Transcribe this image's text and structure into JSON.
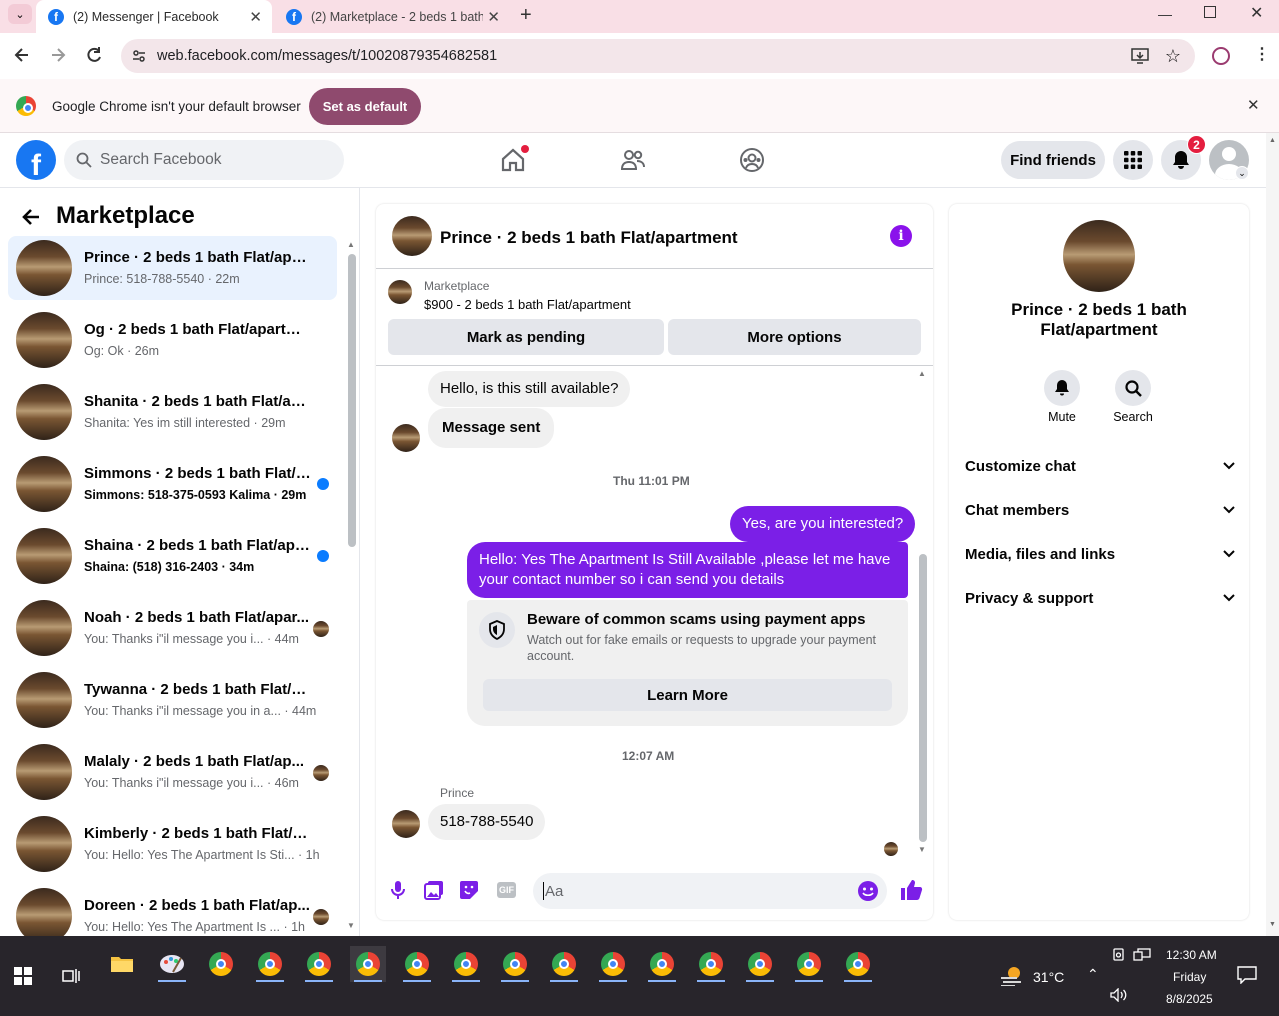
{
  "browser": {
    "tabs": [
      {
        "title": "(2) Messenger | Facebook"
      },
      {
        "title": "(2) Marketplace - 2 beds 1 bath"
      }
    ],
    "url": "web.facebook.com/messages/t/10020879354682581",
    "infobar_text": "Google Chrome isn't your default browser",
    "set_default_label": "Set as default"
  },
  "fb_header": {
    "search_placeholder": "Search Facebook",
    "find_friends_label": "Find friends",
    "notification_count": "2"
  },
  "sidebar": {
    "heading": "Marketplace",
    "conversations": [
      {
        "title": "Prince · 2 beds 1 bath Flat/apart...",
        "preview": "Prince: 518-788-5540",
        "time": "22m",
        "unread": false,
        "indicator": "none",
        "selected": true
      },
      {
        "title": "Og · 2 beds 1 bath Flat/apartment",
        "preview": "Og: Ok",
        "time": "26m",
        "unread": false,
        "indicator": "none",
        "selected": false
      },
      {
        "title": "Shanita · 2 beds 1 bath Flat/apar...",
        "preview": "Shanita: Yes im still interested",
        "time": "29m",
        "unread": false,
        "indicator": "none",
        "selected": false
      },
      {
        "title": "Simmons · 2 beds 1 bath Flat/a...",
        "preview": "Simmons: 518-375-0593 Kalima",
        "time": "29m",
        "unread": true,
        "indicator": "dot",
        "selected": false
      },
      {
        "title": "Shaina · 2 beds 1 bath Flat/apa...",
        "preview": "Shaina: (518) 316-2403",
        "time": "34m",
        "unread": true,
        "indicator": "dot",
        "selected": false
      },
      {
        "title": "Noah · 2 beds 1 bath Flat/apar...",
        "preview": "You: Thanks i\"il message you i...",
        "time": "44m",
        "unread": false,
        "indicator": "avatar",
        "selected": false
      },
      {
        "title": "Tywanna · 2 beds 1 bath Flat/ap...",
        "preview": "You: Thanks i\"il message you in a...",
        "time": "44m",
        "unread": false,
        "indicator": "none",
        "selected": false
      },
      {
        "title": "Malaly · 2 beds 1 bath Flat/ap...",
        "preview": "You: Thanks i\"il message you i...",
        "time": "46m",
        "unread": false,
        "indicator": "avatar",
        "selected": false
      },
      {
        "title": "Kimberly · 2 beds 1 bath Flat/ap...",
        "preview": "You: Hello: Yes The Apartment Is Sti...",
        "time": "1h",
        "unread": false,
        "indicator": "none",
        "selected": false
      },
      {
        "title": "Doreen · 2 beds 1 bath Flat/ap...",
        "preview": "You: Hello: Yes The Apartment Is ...",
        "time": "1h",
        "unread": false,
        "indicator": "avatar",
        "selected": false
      }
    ]
  },
  "chat": {
    "title": "Prince · 2 beds 1 bath Flat/apartment",
    "listing_source": "Marketplace",
    "listing_text": "$900 - 2 beds 1 bath Flat/apartment",
    "mark_pending_label": "Mark as pending",
    "more_options_label": "More options",
    "msg_in_1": "Hello, is this still available?",
    "msg_in_2": "Message sent",
    "ts_1": "Thu 11:01 PM",
    "msg_out_1": "Yes, are you interested?",
    "msg_out_2": "Hello: Yes The Apartment Is Still Available ,please let me have your contact number so i can send you details",
    "warning_title": "Beware of common scams using payment apps",
    "warning_text": "Watch out for fake emails or requests to upgrade your payment account.",
    "learn_more_label": "Learn More",
    "ts_2": "12:07 AM",
    "sender_name": "Prince",
    "msg_in_3": "518-788-5540",
    "composer_placeholder": "Aa"
  },
  "details": {
    "name": "Prince · 2 beds 1 bath Flat/apartment",
    "mute_label": "Mute",
    "search_label": "Search",
    "sections": [
      "Customize chat",
      "Chat members",
      "Media, files and links",
      "Privacy & support"
    ]
  },
  "taskbar": {
    "temperature": "31°C",
    "time": "12:30 AM",
    "day": "Friday",
    "date": "8/8/2025"
  },
  "colors": {
    "fb_blue": "#1877f2",
    "messenger_purple": "#7b1fe7",
    "unread_dot": "#0a7cff",
    "notification_red": "#e41e3f"
  }
}
